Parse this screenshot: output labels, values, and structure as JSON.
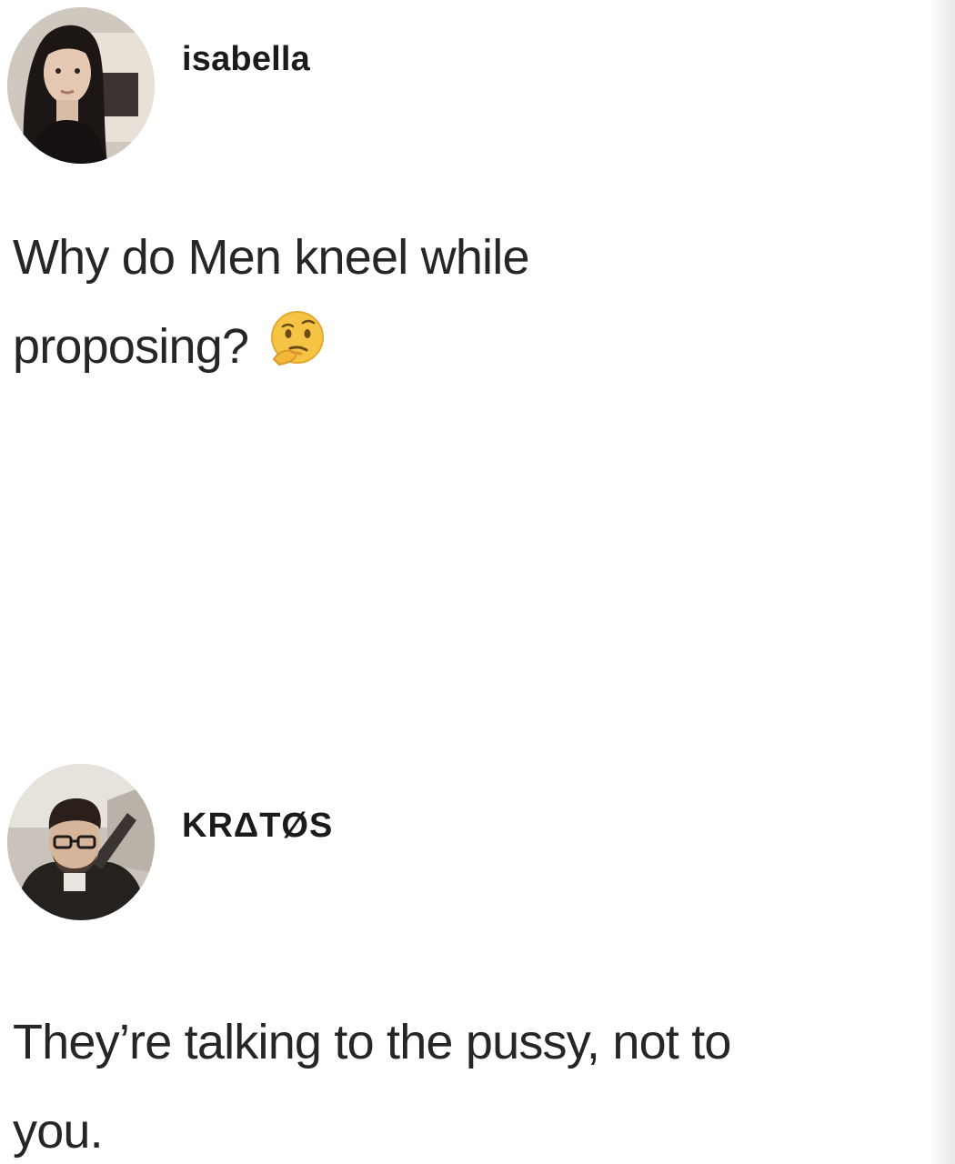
{
  "posts": [
    {
      "author": "isabella",
      "text_line1": "Why do Men kneel while",
      "text_line2": "proposing?",
      "emoji": "thinking-face-icon"
    },
    {
      "author": "KRΔTØS",
      "text_line1": "They’re talking to the pussy, not to",
      "text_line2": "you."
    }
  ],
  "colors": {
    "background": "#ffffff",
    "text": "#262626",
    "username": "#1b1b1b"
  }
}
